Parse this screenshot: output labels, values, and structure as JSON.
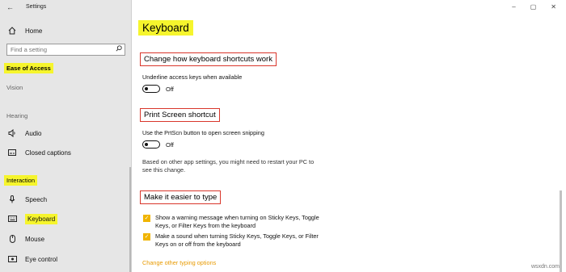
{
  "window": {
    "title": "Settings",
    "minimize": "–",
    "maximize": "▢",
    "close": "✕",
    "back": "←"
  },
  "sidebar": {
    "home": {
      "label": "Home",
      "icon": "home-icon"
    },
    "search": {
      "placeholder": "Find a setting",
      "icon": "search-icon"
    },
    "category": "Ease of Access",
    "sections": {
      "vision": "Vision",
      "hearing": "Hearing",
      "interaction": "Interaction"
    },
    "items": [
      {
        "label": "Audio",
        "icon": "speaker-icon"
      },
      {
        "label": "Closed captions",
        "icon": "closed-captions-icon"
      },
      {
        "label": "Speech",
        "icon": "microphone-icon"
      },
      {
        "label": "Keyboard",
        "icon": "keyboard-icon"
      },
      {
        "label": "Mouse",
        "icon": "mouse-icon"
      },
      {
        "label": "Eye control",
        "icon": "eye-control-icon"
      }
    ]
  },
  "main": {
    "title": "Keyboard",
    "shortcuts": {
      "heading": "Change how keyboard shortcuts work",
      "desc": "Underline access keys when available",
      "state": "Off"
    },
    "printscreen": {
      "heading": "Print Screen shortcut",
      "desc": "Use the PrtScn button to open screen snipping",
      "state": "Off",
      "note_line1": "Based on other app settings, you might need to restart your PC to",
      "note_line2": "see this change."
    },
    "typing": {
      "heading": "Make it easier to type",
      "check1_line1": "Show a warning message when turning on Sticky Keys, Toggle",
      "check1_line2": "Keys, or Filter Keys from the keyboard",
      "check2_line1": "Make a sound when turning Sticky Keys, Toggle Keys, or Filter",
      "check2_line2": "Keys on or off from the keyboard",
      "link": "Change other typing options"
    }
  },
  "watermark": "wsxdn.com",
  "colors": {
    "highlight": "#f6f52d",
    "red_box": "#d9362b",
    "accent_checkbox": "#f0b400",
    "link": "#e89a00",
    "sidebar_bg": "#e6e6e6"
  }
}
